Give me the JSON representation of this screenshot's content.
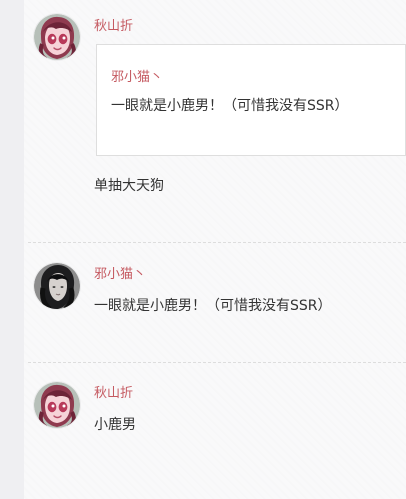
{
  "comments": [
    {
      "author": "秋山折",
      "reply_to": {
        "author": "邪小猫丶",
        "text": "一眼就是小鹿男！（可惜我没有SSR）"
      },
      "text": "单抽大天狗",
      "avatar_icon": "anime-girl-avatar-icon"
    },
    {
      "author": "邪小猫丶",
      "text": "一眼就是小鹿男！（可惜我没有SSR）",
      "avatar_icon": "dark-hair-girl-avatar-icon"
    },
    {
      "author": "秋山折",
      "text": "小鹿男",
      "avatar_icon": "anime-girl-avatar-icon"
    }
  ],
  "colors": {
    "author": "#c55a61",
    "text": "#333333",
    "border": "#dedede",
    "background": "#f4f4f6"
  }
}
